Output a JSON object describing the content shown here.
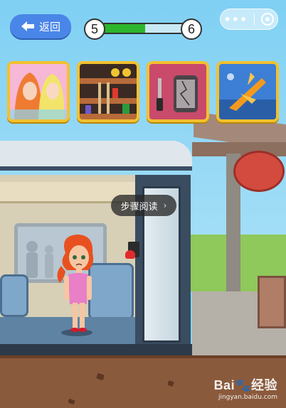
{
  "hud": {
    "back_label": "返回",
    "level_current": "5",
    "level_next": "6",
    "level_progress": 0.5,
    "menu_dots": "•••"
  },
  "games": [
    {
      "name": "fashion-dressup-game",
      "icon": "princess-hair-icon"
    },
    {
      "name": "pixel-platformer-game",
      "icon": "mario-ladder-icon"
    },
    {
      "name": "phone-repair-game",
      "icon": "cracked-phone-screwdriver-icon"
    },
    {
      "name": "jet-fighter-game",
      "icon": "fighter-jet-icon"
    }
  ],
  "tooltip": {
    "text": "步骤阅读"
  },
  "watermark": {
    "main": "Bai",
    "main_suffix": "经验",
    "sub": "jingyan.baidu.com"
  },
  "colors": {
    "accent_blue": "#4a86e8",
    "progress_green": "#2db52d",
    "thumb_border": "#f2c12e"
  }
}
